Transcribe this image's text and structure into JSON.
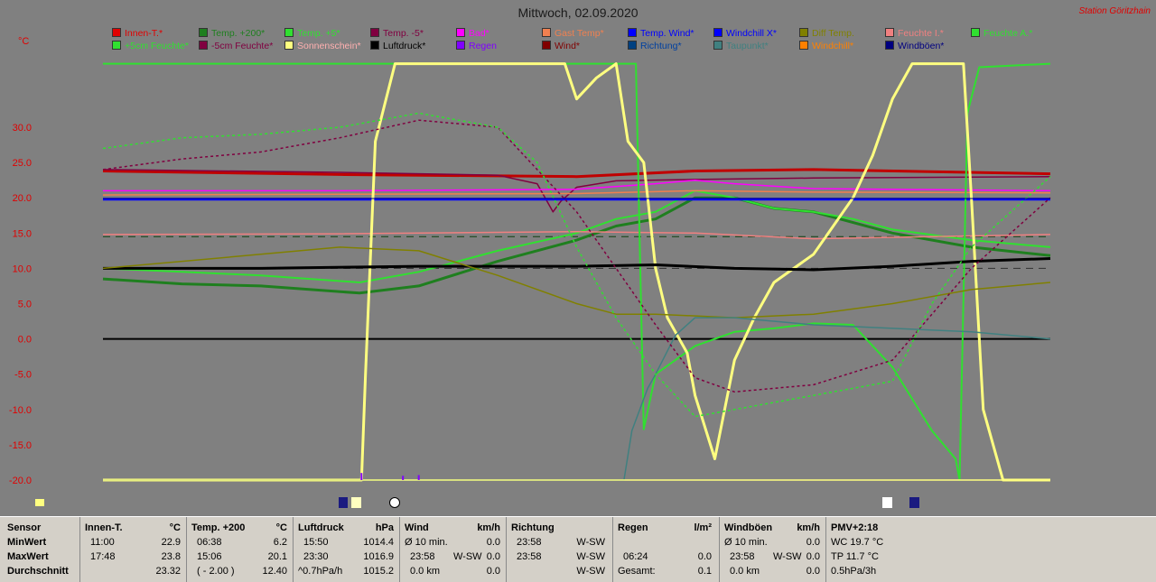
{
  "title": "Mittwoch, 02.09.2020",
  "station": "Station Göritzhain",
  "unit": "°C",
  "legend_row1": [
    {
      "label": "Innen-T.*",
      "color": "#e00000"
    },
    {
      "label": "Temp. +200*",
      "color": "#1f7f1f"
    },
    {
      "label": "Temp. +5*",
      "color": "#30e030"
    },
    {
      "label": "Temp. -5*",
      "color": "#800040"
    },
    {
      "label": "Bad*",
      "color": "#ff00ff"
    },
    {
      "label": "Gast Temp*",
      "color": "#f08050"
    },
    {
      "label": "Temp. Wind*",
      "color": "#0000ff"
    },
    {
      "label": "Windchill X*",
      "color": "#0000ff"
    },
    {
      "label": "Diff Temp.",
      "color": "#808000"
    },
    {
      "label": "Feuchte I.*",
      "color": "#f08080"
    },
    {
      "label": "Feuchte A.*",
      "color": "#30e030"
    }
  ],
  "legend_row2": [
    {
      "label": "+5cm Feuchte*",
      "color": "#30e030"
    },
    {
      "label": "-5cm Feuchte*",
      "color": "#800040"
    },
    {
      "label": "Sonnenschein*",
      "color": "#ffff80"
    },
    {
      "label": "Luftdruck*",
      "color": "#000000"
    },
    {
      "label": "Regen",
      "color": "#8000ff"
    },
    {
      "label": "Wind*",
      "color": "#800000"
    },
    {
      "label": "Richtung*",
      "color": "#004080"
    },
    {
      "label": "Taupunkt*",
      "color": "#408080"
    },
    {
      "label": "Windchill*",
      "color": "#ff8000"
    },
    {
      "label": "Windböen*",
      "color": "#000080"
    }
  ],
  "chart_data": {
    "type": "line",
    "ylabel": "°C",
    "yticks": [
      "30.0",
      "25.0",
      "20.0",
      "15.0",
      "10.0",
      "5.0",
      "0.0",
      "-5.0",
      "-10.0",
      "-15.0",
      "-20.0"
    ],
    "ylim": [
      -20,
      30
    ],
    "xlim": [
      0,
      24
    ],
    "grid": false,
    "series": [
      {
        "name": "Innen-T.*",
        "color": "#c00000",
        "x": [
          0,
          6,
          12,
          15,
          18,
          24
        ],
        "values": [
          23.8,
          23.3,
          23.0,
          23.8,
          24.0,
          23.4
        ]
      },
      {
        "name": "Temp. +200*",
        "color": "#1f7f1f",
        "x": [
          0,
          2,
          4,
          6.5,
          8,
          10,
          12,
          13,
          14,
          14.5,
          15,
          16,
          17,
          18,
          19,
          20,
          22,
          24
        ],
        "values": [
          8.5,
          7.8,
          7.5,
          6.5,
          7.5,
          11.0,
          14.0,
          16.0,
          17.0,
          18.5,
          20.0,
          20.0,
          18.5,
          18.0,
          16.5,
          15.0,
          13.0,
          11.8
        ]
      },
      {
        "name": "Temp. +5*",
        "color": "#30e030",
        "x": [
          0,
          2,
          4,
          6.5,
          8,
          10,
          12,
          13,
          14,
          14.5,
          15,
          16,
          17,
          18,
          19,
          20,
          22,
          24
        ],
        "values": [
          10.0,
          9.5,
          9.0,
          8.0,
          9.5,
          12.5,
          15.0,
          17.0,
          18.0,
          19.5,
          21.0,
          20.0,
          18.5,
          18.0,
          17.0,
          15.5,
          14.0,
          13.0
        ]
      },
      {
        "name": "Temp. -5*",
        "color": "#800040",
        "x": [
          0,
          6,
          10,
          11,
          11.4,
          11.6,
          12,
          13,
          15,
          18,
          24
        ],
        "values": [
          24.0,
          23.6,
          23.2,
          22.0,
          18.0,
          19.5,
          21.5,
          22.4,
          22.6,
          22.8,
          23.0
        ]
      },
      {
        "name": "Bad*",
        "color": "#ff00ff",
        "x": [
          0,
          6,
          12,
          14,
          15,
          16,
          18,
          24
        ],
        "values": [
          21.0,
          21.0,
          21.2,
          22.0,
          22.5,
          22.0,
          21.3,
          21.0
        ]
      },
      {
        "name": "Gast Temp*",
        "color": "#f08050",
        "x": [
          0,
          6,
          12,
          15,
          18,
          24
        ],
        "values": [
          20.4,
          20.5,
          20.6,
          21.0,
          20.8,
          20.7
        ]
      },
      {
        "name": "Temp. Wind*",
        "color": "#0000ff",
        "x": [
          0,
          24
        ],
        "values": [
          19.8,
          19.8
        ]
      },
      {
        "name": "Feuchte I.*",
        "color": "#f08080",
        "x": [
          0,
          6,
          12,
          15,
          18,
          24
        ],
        "values": [
          14.8,
          14.9,
          15.2,
          15.0,
          14.2,
          14.8
        ]
      },
      {
        "name": "Feuchte A.*",
        "color": "#30e030",
        "x": [
          0,
          13.3,
          13.5,
          13.7,
          14,
          14.5,
          15,
          16,
          17,
          18,
          19,
          20,
          21,
          21.6,
          21.7,
          21.9,
          22.2,
          24
        ],
        "values": [
          39,
          39,
          39,
          -12.8,
          -5.0,
          -3.0,
          -1.0,
          1.0,
          1.5,
          2.2,
          2.0,
          -4.0,
          -13.0,
          -17.0,
          -20.0,
          32.0,
          38.5,
          39.0
        ]
      },
      {
        "name": "Sonnenschein*",
        "color": "#ffff80",
        "x": [
          0,
          6.55,
          6.65,
          6.9,
          7.4,
          8,
          10,
          11.7,
          12,
          12.5,
          13,
          13.3,
          13.7,
          14,
          14.3,
          14.8,
          15,
          15.5,
          16,
          16.5,
          17,
          18,
          19,
          19.5,
          20,
          20.5,
          21.5,
          21.8,
          22,
          22.3,
          22.8,
          24
        ],
        "values": [
          -20.0,
          -20.0,
          -5.0,
          28.0,
          39.0,
          39.0,
          39.0,
          39.0,
          34.0,
          37.0,
          39.0,
          28.0,
          25.0,
          10.0,
          3.0,
          -2.0,
          -8.0,
          -17.0,
          -3.0,
          3.0,
          8.0,
          12.0,
          20.0,
          26.0,
          34.0,
          39.0,
          39.0,
          39.0,
          20.0,
          -10.0,
          -20.0,
          -20.0
        ]
      },
      {
        "name": "Luftdruck*",
        "color": "#000000",
        "x": [
          0,
          4,
          8,
          12,
          14,
          16,
          18,
          20,
          22,
          24
        ],
        "values": [
          10.0,
          10.0,
          10.3,
          10.3,
          10.5,
          10.0,
          9.8,
          10.3,
          11.0,
          11.4
        ]
      },
      {
        "name": "Diff Temp.",
        "color": "#808000",
        "x": [
          0,
          4,
          6,
          8,
          10,
          12,
          13,
          14,
          16,
          18,
          20,
          22,
          24
        ],
        "values": [
          10.0,
          12.0,
          13.0,
          12.5,
          9.0,
          5.0,
          3.5,
          3.5,
          3.0,
          3.5,
          5.0,
          7.0,
          8.0
        ]
      },
      {
        "name": "Taupunkt*",
        "color": "#408080",
        "x": [
          0,
          13.2,
          13.4,
          13.8,
          14,
          14.5,
          15,
          16,
          18,
          22,
          24
        ],
        "values": [
          -20,
          -20,
          -13.0,
          -7.0,
          -5.0,
          0.5,
          3.0,
          3.0,
          2.0,
          1.0,
          0.0
        ]
      },
      {
        "name": "-5cm Feuchte*",
        "color": "#800040",
        "x": [
          0,
          2,
          4,
          6,
          8,
          10,
          12,
          13,
          14,
          15,
          16,
          18,
          20,
          22,
          24
        ],
        "values": [
          24.0,
          25.5,
          26.5,
          28.5,
          31.0,
          30.0,
          18.0,
          10.0,
          2.0,
          -5.5,
          -7.5,
          -6.5,
          -3.0,
          10.0,
          20.0
        ]
      },
      {
        "name": "+5cm Feuchte*",
        "color": "#30e030",
        "x": [
          0,
          2,
          4,
          6,
          8,
          10,
          11,
          12,
          13,
          14,
          15,
          16,
          18,
          20,
          21,
          22,
          24
        ],
        "values": [
          27.0,
          28.5,
          29.0,
          30.0,
          32.0,
          30.0,
          25.0,
          13.0,
          3.0,
          -5.0,
          -11.0,
          -10.0,
          -8.0,
          -6.0,
          5.0,
          13.0,
          23.0
        ]
      },
      {
        "name": "Windböen*",
        "color": "#000080",
        "x": [
          0,
          24
        ],
        "values": [
          19.9,
          19.9
        ]
      }
    ],
    "hlines": [
      {
        "value": 0.0,
        "color": "#000000"
      },
      {
        "value": 14.5,
        "color": "#104010"
      },
      {
        "value": 10.0,
        "color": "#303030"
      }
    ],
    "markers": [
      "sun-icon",
      "sunrise-icon",
      "moon-icon",
      "sunset-icon",
      "moon-phase-icon"
    ]
  },
  "table": {
    "c1": {
      "h": "Sensor",
      "r": [
        "MinWert",
        "MaxWert",
        "Durchschnitt"
      ]
    },
    "c2": {
      "h": "Innen-T.",
      "u": "°C",
      "r": [
        [
          "11:00",
          "22.9"
        ],
        [
          "17:48",
          "23.8"
        ],
        [
          "",
          "23.32"
        ]
      ]
    },
    "c3": {
      "h": "Temp. +200",
      "u": "°C",
      "r": [
        [
          "06:38",
          "6.2"
        ],
        [
          "15:06",
          "20.1"
        ],
        [
          "( - 2.00 )",
          "12.40"
        ]
      ]
    },
    "c4": {
      "h": "Luftdruck",
      "u": "hPa",
      "r": [
        [
          "15:50",
          "1014.4"
        ],
        [
          "23:30",
          "1016.9"
        ],
        [
          "^0.7hPa/h",
          "1015.2"
        ]
      ]
    },
    "c5": {
      "h": "Wind",
      "u": "km/h",
      "r": [
        [
          "Ø 10 min.",
          "",
          "0.0"
        ],
        [
          "23:58",
          "W-SW",
          "0.0"
        ],
        [
          "0.0 km",
          "",
          "0.0"
        ]
      ]
    },
    "c6": {
      "h": "Richtung",
      "r": [
        [
          "23:58",
          "W-SW"
        ],
        [
          "23:58",
          "W-SW"
        ],
        [
          "",
          "W-SW"
        ]
      ]
    },
    "c7": {
      "h": "Regen",
      "u": "l/m²",
      "r": [
        [
          "",
          ""
        ],
        [
          "06:24",
          "0.0"
        ],
        [
          "Gesamt:",
          "0.1"
        ]
      ]
    },
    "c8": {
      "h": "Windböen",
      "u": "km/h",
      "r": [
        [
          "Ø 10 min.",
          "",
          "0.0"
        ],
        [
          "23:58",
          "W-SW",
          "0.0"
        ],
        [
          "0.0 km",
          "",
          "0.0"
        ]
      ]
    },
    "c9": {
      "h": "PMV+2:18",
      "r": [
        "WC 19.7 °C",
        "TP 11.7 °C",
        "0.5hPa/3h"
      ]
    }
  }
}
